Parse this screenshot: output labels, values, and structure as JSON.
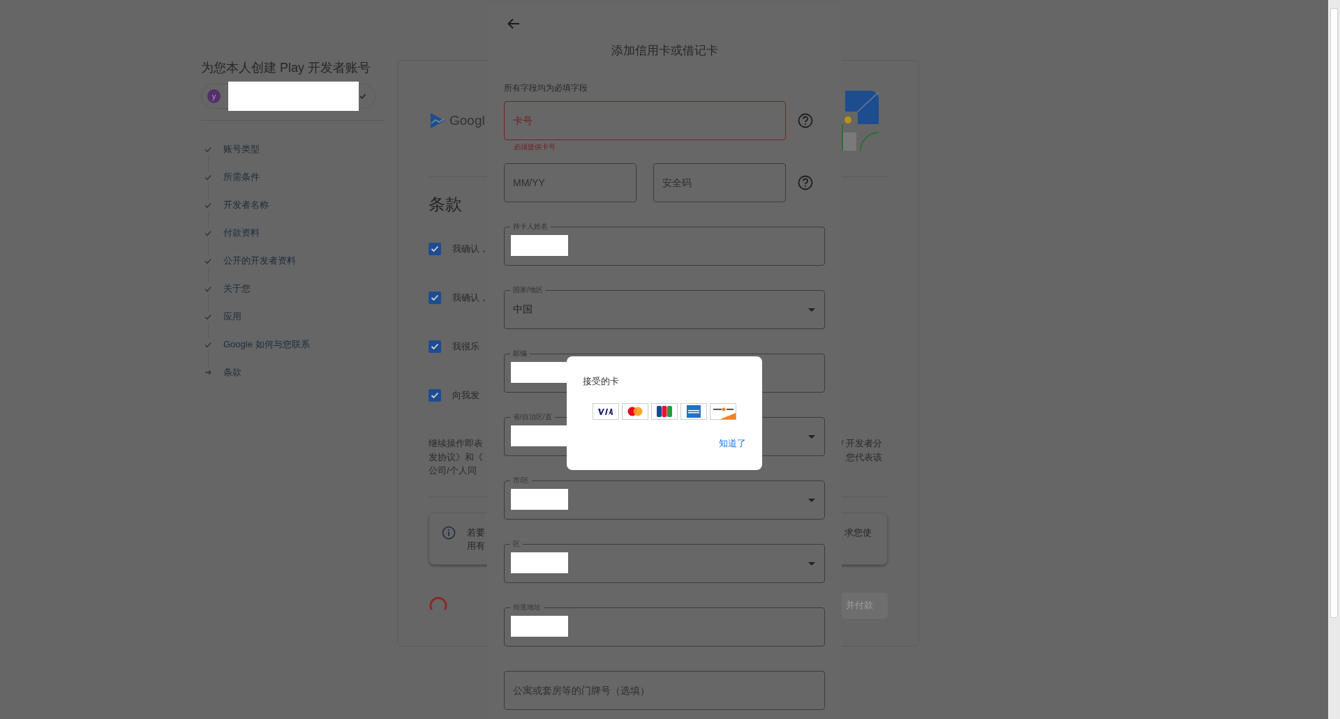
{
  "sidebar": {
    "title": "为您本人创建 Play 开发者账号",
    "account": {
      "avatar_letter": "y",
      "redacted": true
    },
    "steps": [
      {
        "label": "账号类型",
        "completed": true
      },
      {
        "label": "所需条件",
        "completed": true
      },
      {
        "label": "开发者名称",
        "completed": true
      },
      {
        "label": "付款资料",
        "completed": true
      },
      {
        "label": "公开的开发者资料",
        "completed": true
      },
      {
        "label": "关于您",
        "completed": true
      },
      {
        "label": "应用",
        "completed": true
      },
      {
        "label": "Google 如何与您联系",
        "completed": true
      },
      {
        "label": "条款",
        "completed": false
      }
    ]
  },
  "card": {
    "logo_text": "Googl",
    "heading": "条款",
    "checkboxes": [
      {
        "text": "我确认，",
        "checked": true
      },
      {
        "text": "我确认，",
        "checked": true
      },
      {
        "text": "我很乐",
        "checked": true
      },
      {
        "text": "向我发",
        "checked": true
      }
    ],
    "notice_left": [
      "继续操作即表",
      "发协议》和《",
      "公司/个人同"
    ],
    "notice_right": [
      "/ 开发者分",
      "您代表该"
    ],
    "info_left": [
      "若要",
      "用有"
    ],
    "info_right": "求您使",
    "loading": true,
    "button": {
      "label": "并付款",
      "disabled": true
    }
  },
  "dialog": {
    "title": "添加信用卡或借记卡",
    "note": "所有字段均为必填字段",
    "rows": [
      {
        "help": true,
        "fields": [
          {
            "placeholder": "卡号",
            "invalid": true,
            "error": "必须提供卡号"
          }
        ]
      },
      {
        "help": true,
        "fields": [
          {
            "placeholder": "MM/YY"
          },
          {
            "placeholder": "安全码"
          }
        ]
      },
      {
        "fields": [
          {
            "label": "持卡人姓名",
            "redacted": true
          }
        ]
      },
      {
        "fields": [
          {
            "label": "国家/地区",
            "value": "中国",
            "dropdown": true
          }
        ]
      },
      {
        "fields": [
          {
            "label": "邮编",
            "redacted": true
          }
        ]
      },
      {
        "fields": [
          {
            "label": "省/自治区/直",
            "redacted": true,
            "dropdown": true
          }
        ]
      },
      {
        "fields": [
          {
            "label": "市/区",
            "redacted": true,
            "dropdown": true
          }
        ]
      },
      {
        "fields": [
          {
            "label": "区",
            "redacted": true,
            "dropdown": true
          }
        ]
      },
      {
        "fields": [
          {
            "label": "街道地址",
            "redacted": true
          }
        ]
      },
      {
        "fields": [
          {
            "placeholder": "公寓或套房等的门牌号（选填）"
          }
        ]
      }
    ]
  },
  "popup": {
    "title": "接受的卡",
    "cards": [
      {
        "kind": "visa"
      },
      {
        "kind": "mastercard"
      },
      {
        "kind": "jcb"
      },
      {
        "kind": "amex"
      },
      {
        "kind": "discover"
      }
    ],
    "action": "知道了"
  }
}
